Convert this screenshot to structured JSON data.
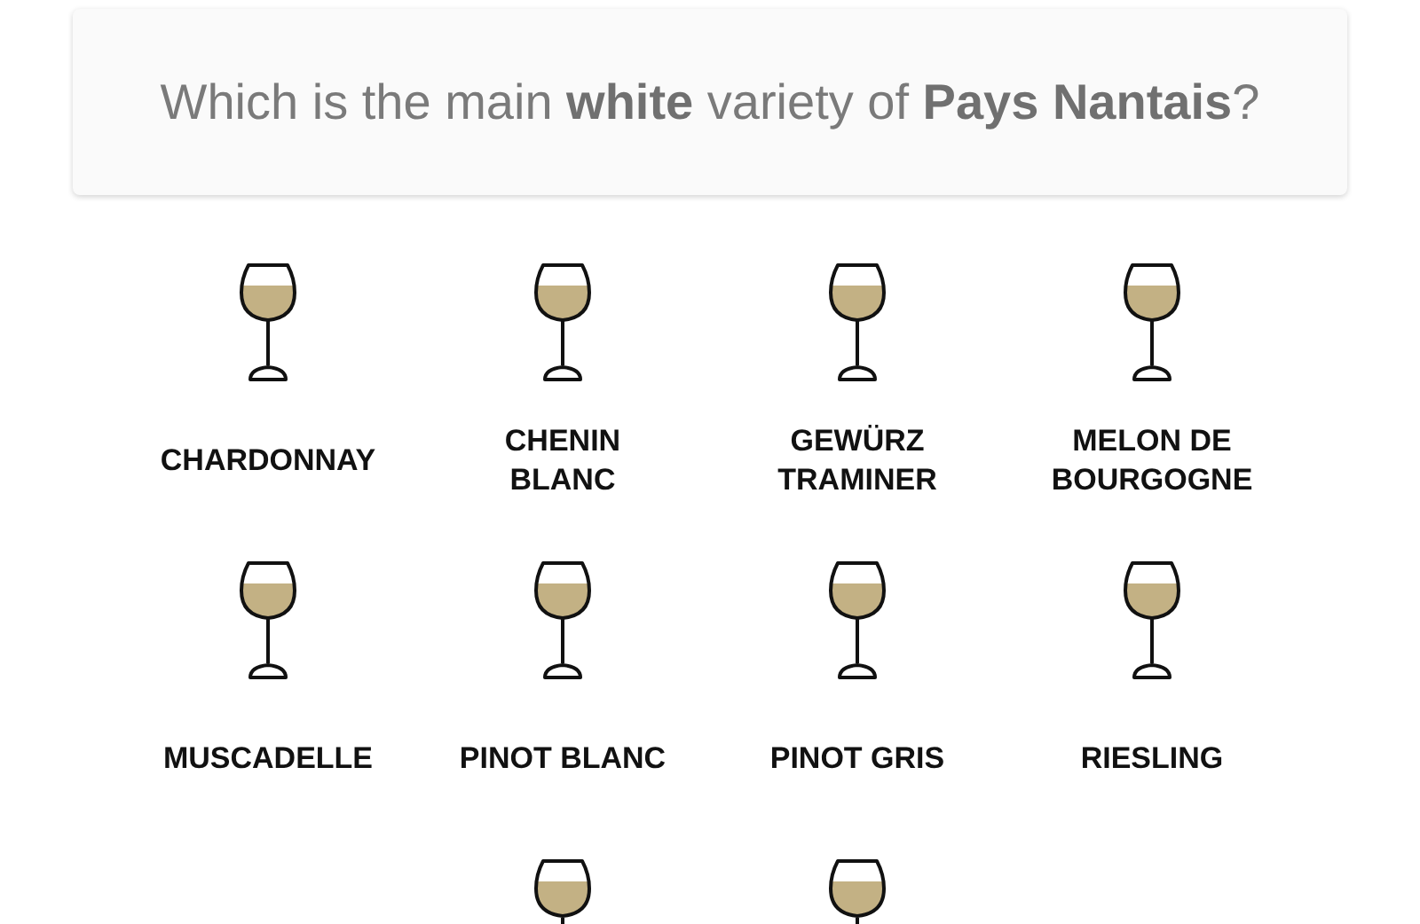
{
  "question": "Which is the main **white** variety of **Pays Nantais**?",
  "options": [
    {
      "label": "CHARDONNAY"
    },
    {
      "label": "CHENIN\nBLANC"
    },
    {
      "label": "GEWÜRZ\nTRAMINER"
    },
    {
      "label": "MELON DE\nBOURGOGNE"
    },
    {
      "label": "MUSCADELLE"
    },
    {
      "label": "PINOT BLANC"
    },
    {
      "label": "PINOT GRIS"
    },
    {
      "label": "RIESLING"
    }
  ],
  "cut_off_row": [
    {
      "kind": "blank"
    },
    {
      "kind": "glass"
    },
    {
      "kind": "glass"
    },
    {
      "kind": "blank"
    }
  ]
}
